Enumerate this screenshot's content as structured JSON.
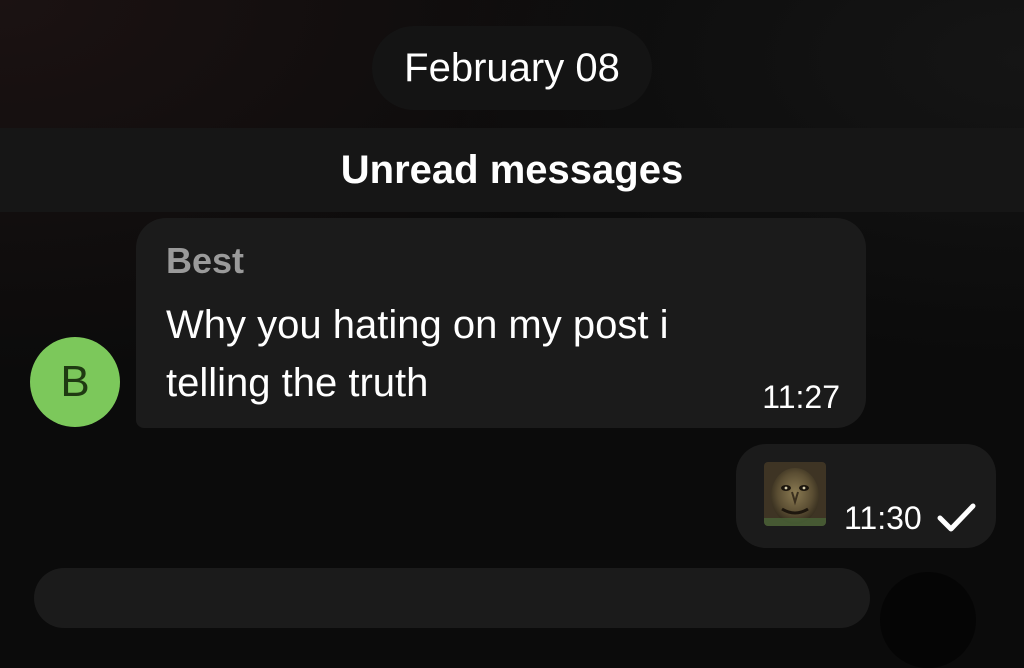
{
  "chat": {
    "date_label": "February 08",
    "unread_label": "Unread messages",
    "incoming": {
      "sender": "Best",
      "avatar_initial": "B",
      "avatar_color": "#7cc85b",
      "text": "Why you hating on my post i telling the truth",
      "time": "11:27"
    },
    "outgoing": {
      "time": "11:30",
      "status_icon": "checkmark-icon",
      "sticker_icon": "face-sticker-image"
    }
  },
  "colors": {
    "background": "#0b0b0b",
    "bubble": "#1b1b1b",
    "sender_name": "#9a9a9a"
  }
}
